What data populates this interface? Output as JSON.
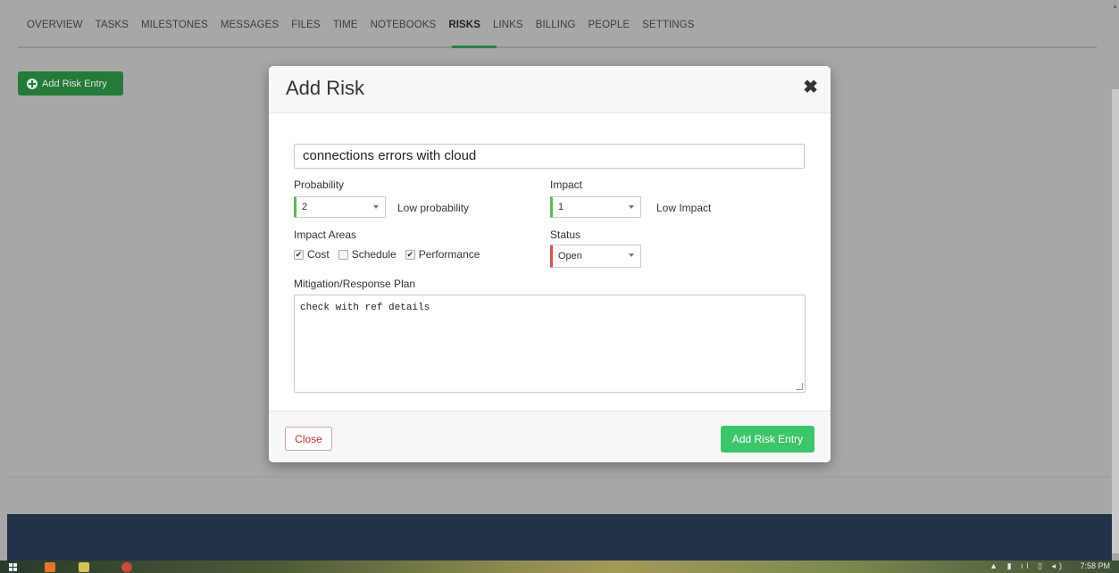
{
  "nav": {
    "tabs": [
      "OVERVIEW",
      "TASKS",
      "MILESTONES",
      "MESSAGES",
      "FILES",
      "TIME",
      "NOTEBOOKS",
      "RISKS",
      "LINKS",
      "BILLING",
      "PEOPLE",
      "SETTINGS"
    ],
    "active": "RISKS"
  },
  "page": {
    "add_risk_button": "Add Risk Entry"
  },
  "modal": {
    "title": "Add Risk",
    "risk_title_value": "connections errors with cloud",
    "probability": {
      "label": "Probability",
      "value": "2",
      "description": "Low probability"
    },
    "impact": {
      "label": "Impact",
      "value": "1",
      "description": "Low Impact"
    },
    "impact_areas": {
      "label": "Impact Areas",
      "options": [
        {
          "label": "Cost",
          "checked": true
        },
        {
          "label": "Schedule",
          "checked": false
        },
        {
          "label": "Performance",
          "checked": true
        }
      ]
    },
    "status": {
      "label": "Status",
      "value": "Open"
    },
    "plan": {
      "label": "Mitigation/Response Plan",
      "value": "check with ref details"
    },
    "close_button": "Close",
    "submit_button": "Add Risk Entry"
  },
  "taskbar": {
    "time": "7:58 PM"
  },
  "colors": {
    "primary_green": "#3cc66a",
    "page_green": "#257a39",
    "status_red": "#d9534f",
    "select_green": "#5cb85c",
    "footer_navy": "#233347"
  }
}
